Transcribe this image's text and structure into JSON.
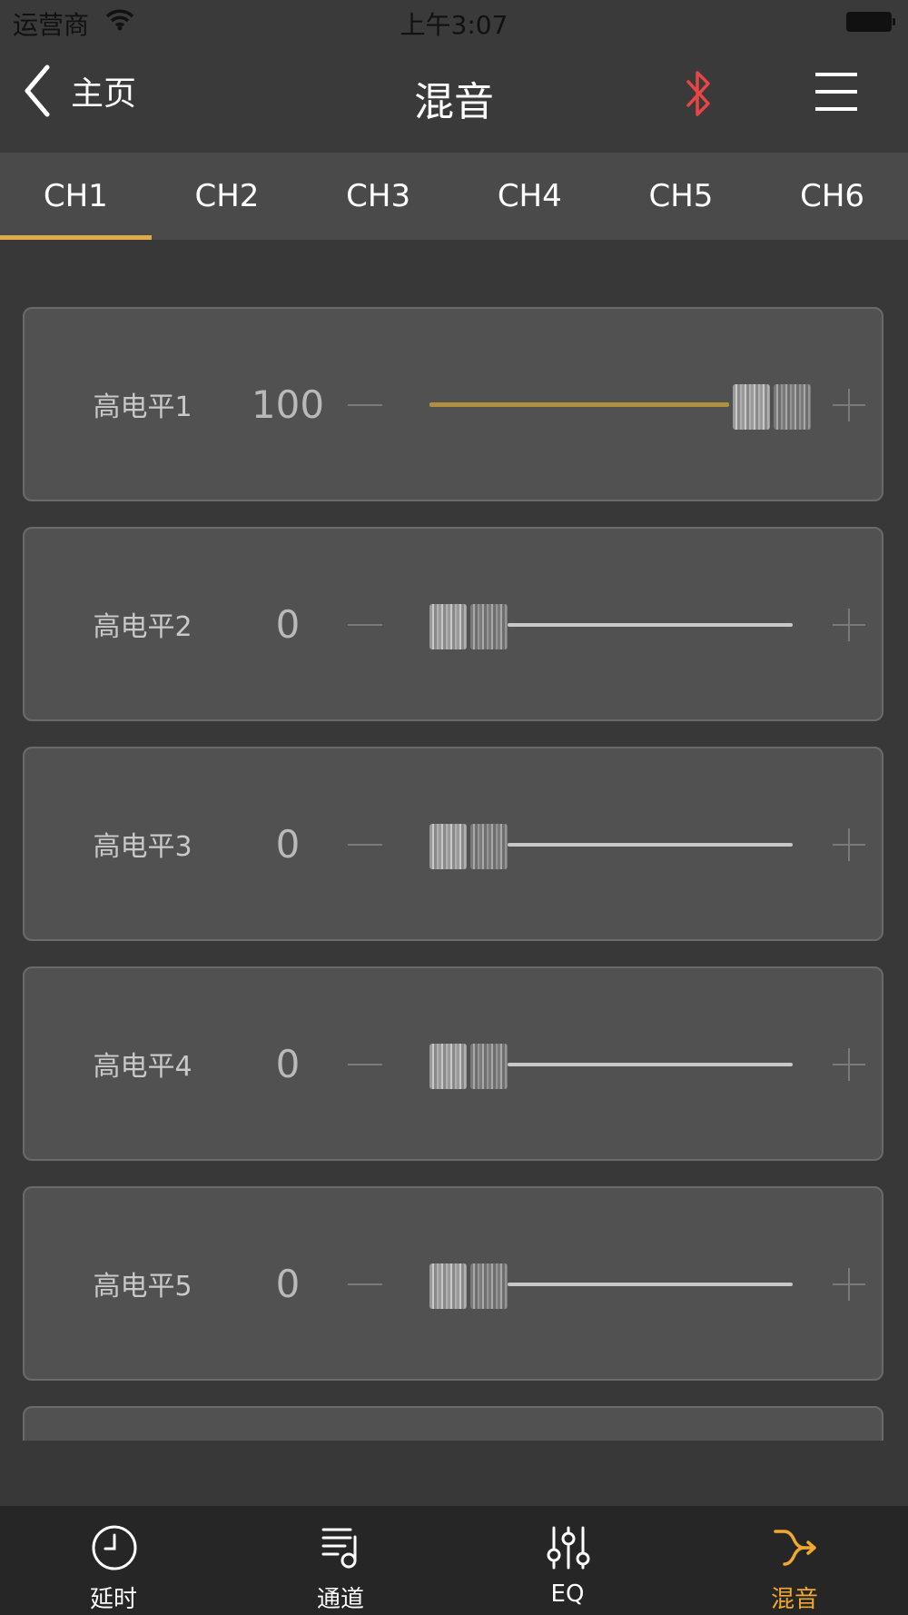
{
  "status_bar": {
    "carrier": "运营商",
    "time": "上午3:07"
  },
  "nav": {
    "back_label": "主页",
    "title": "混音"
  },
  "colors": {
    "accent": "#e0a94a",
    "bluetooth": "#e84545",
    "active_tab": "#f0a830"
  },
  "channel_tabs": [
    "CH1",
    "CH2",
    "CH3",
    "CH4",
    "CH5",
    "CH6"
  ],
  "active_channel": "CH1",
  "mixer_rows": [
    {
      "label": "高电平1",
      "value": "100",
      "level": 1.0
    },
    {
      "label": "高电平2",
      "value": "0",
      "level": 0.0
    },
    {
      "label": "高电平3",
      "value": "0",
      "level": 0.0
    },
    {
      "label": "高电平4",
      "value": "0",
      "level": 0.0
    },
    {
      "label": "高电平5",
      "value": "0",
      "level": 0.0
    }
  ],
  "bottom_tabs": [
    {
      "label": "延时",
      "icon": "clock-icon"
    },
    {
      "label": "通道",
      "icon": "channel-list-icon"
    },
    {
      "label": "EQ",
      "icon": "eq-sliders-icon"
    },
    {
      "label": "混音",
      "icon": "mix-merge-icon"
    }
  ],
  "active_bottom_tab": "混音"
}
